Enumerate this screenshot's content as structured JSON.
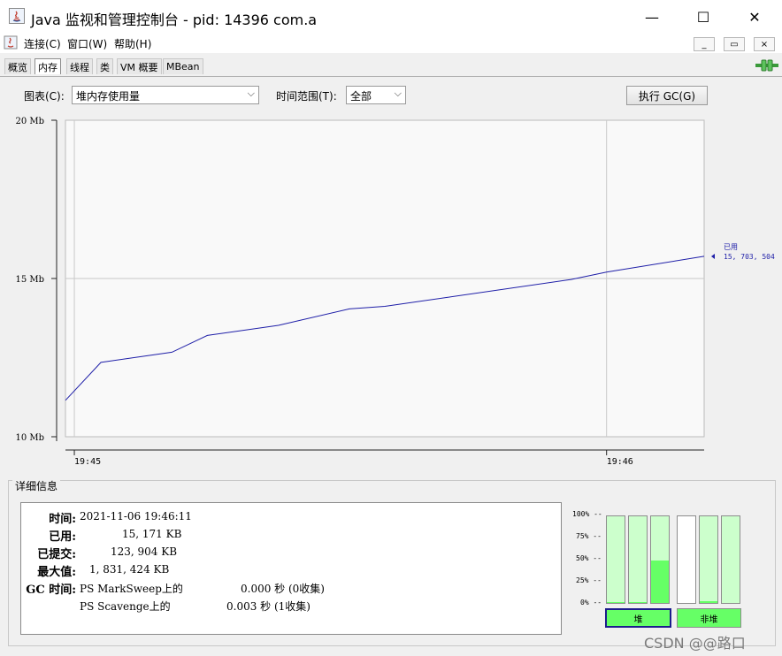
{
  "window": {
    "title": "Java 监视和管理控制台 - pid: 14396 com.a",
    "controls": {
      "minimize": "—",
      "maximize": "☐",
      "close": "✕"
    }
  },
  "menu": {
    "items": [
      "连接(C)",
      "窗口(W)",
      "帮助(H)"
    ],
    "mdi_controls": [
      "_",
      "▭",
      "×"
    ]
  },
  "tabs": [
    {
      "label": "概览",
      "active": false
    },
    {
      "label": "内存",
      "active": true
    },
    {
      "label": "线程",
      "active": false
    },
    {
      "label": "类",
      "active": false
    },
    {
      "label": "VM 概要",
      "active": false
    },
    {
      "label": "MBean",
      "active": false
    }
  ],
  "controls": {
    "chart_label": "图表(C):",
    "chart_selected": "堆内存使用量",
    "range_label": "时间范围(T):",
    "range_selected": "全部",
    "gc_button": "执行 GC(G)"
  },
  "chart_data": {
    "type": "line",
    "ylim": [
      10,
      20
    ],
    "y_ticks": [
      {
        "value": 20,
        "label": "20 Mb"
      },
      {
        "value": 15,
        "label": "15 Mb"
      },
      {
        "value": 10,
        "label": "10 Mb"
      }
    ],
    "x_ticks": [
      {
        "value": "19:45:00",
        "label": "19:45"
      },
      {
        "value": "19:46:00",
        "label": "19:46"
      }
    ],
    "xlim": [
      "19:44:59",
      "19:46:11"
    ],
    "series": [
      {
        "name": "已用",
        "color": "#1f1fa8",
        "points": [
          {
            "x": "19:44:59",
            "y": 11.15
          },
          {
            "x": "19:45:03",
            "y": 12.35
          },
          {
            "x": "19:45:11",
            "y": 12.67
          },
          {
            "x": "19:45:15",
            "y": 13.2
          },
          {
            "x": "19:45:23",
            "y": 13.52
          },
          {
            "x": "19:45:31",
            "y": 14.04
          },
          {
            "x": "19:45:35",
            "y": 14.12
          },
          {
            "x": "19:45:56",
            "y": 14.97
          },
          {
            "x": "19:46:00",
            "y": 15.2
          },
          {
            "x": "19:46:11",
            "y": 15.7
          }
        ]
      }
    ],
    "current": {
      "label": "已用",
      "value": "15, 703, 504"
    },
    "grid": true
  },
  "details": {
    "title": "详细信息",
    "rows": [
      {
        "label": "时间:",
        "value": "2021-11-06 19:46:11"
      },
      {
        "label": "已用:",
        "value": "15, 171 KB"
      },
      {
        "label": "已提交:",
        "value": "123, 904 KB"
      },
      {
        "label": "最大值:",
        "value": "1, 831, 424 KB"
      },
      {
        "label": "GC 时间:",
        "value": "PS MarkSweep上的",
        "extra": "0.000 秒 (0收集)"
      },
      {
        "label": "",
        "value": "PS Scavenge上的",
        "extra": "0.003 秒 (1收集)"
      }
    ]
  },
  "pools": {
    "y_labels": [
      "100% --",
      "75% --",
      "50% --",
      "25% --",
      "0% --"
    ],
    "heap_bars": [
      0.01,
      0.01,
      0.49
    ],
    "nonheap_bars": [
      0.0,
      0.02,
      0.0
    ],
    "heap_label": "堆",
    "nonheap_label": "非堆"
  },
  "watermark": "CSDN @@路口"
}
